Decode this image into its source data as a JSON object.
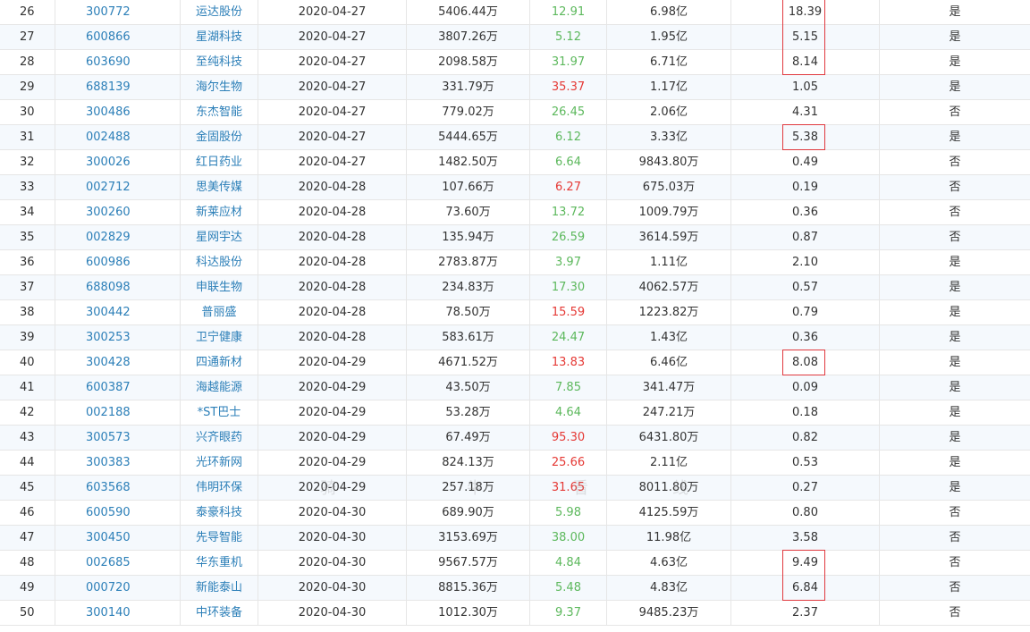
{
  "colors": {
    "link": "#2c7fb8",
    "positive": "#5cb85c",
    "negative": "#e53935",
    "highlight_border": "#e0393e"
  },
  "rows": [
    {
      "idx": "26",
      "code": "300772",
      "name": "运达股份",
      "date": "2020-04-27",
      "amount": "5406.44万",
      "pct": "12.91",
      "dir": "up",
      "cap": "6.98亿",
      "ratio": "18.39",
      "flag": "是",
      "hl": true
    },
    {
      "idx": "27",
      "code": "600866",
      "name": "星湖科技",
      "date": "2020-04-27",
      "amount": "3807.26万",
      "pct": "5.12",
      "dir": "up",
      "cap": "1.95亿",
      "ratio": "5.15",
      "flag": "是",
      "hl": true
    },
    {
      "idx": "28",
      "code": "603690",
      "name": "至纯科技",
      "date": "2020-04-27",
      "amount": "2098.58万",
      "pct": "31.97",
      "dir": "up",
      "cap": "6.71亿",
      "ratio": "8.14",
      "flag": "是",
      "hl": true
    },
    {
      "idx": "29",
      "code": "688139",
      "name": "海尔生物",
      "date": "2020-04-27",
      "amount": "331.79万",
      "pct": "35.37",
      "dir": "down",
      "cap": "1.17亿",
      "ratio": "1.05",
      "flag": "是",
      "hl": false
    },
    {
      "idx": "30",
      "code": "300486",
      "name": "东杰智能",
      "date": "2020-04-27",
      "amount": "779.02万",
      "pct": "26.45",
      "dir": "up",
      "cap": "2.06亿",
      "ratio": "4.31",
      "flag": "否",
      "hl": false
    },
    {
      "idx": "31",
      "code": "002488",
      "name": "金固股份",
      "date": "2020-04-27",
      "amount": "5444.65万",
      "pct": "6.12",
      "dir": "up",
      "cap": "3.33亿",
      "ratio": "5.38",
      "flag": "是",
      "hl": true
    },
    {
      "idx": "32",
      "code": "300026",
      "name": "红日药业",
      "date": "2020-04-27",
      "amount": "1482.50万",
      "pct": "6.64",
      "dir": "up",
      "cap": "9843.80万",
      "ratio": "0.49",
      "flag": "否",
      "hl": false
    },
    {
      "idx": "33",
      "code": "002712",
      "name": "思美传媒",
      "date": "2020-04-28",
      "amount": "107.66万",
      "pct": "6.27",
      "dir": "down",
      "cap": "675.03万",
      "ratio": "0.19",
      "flag": "否",
      "hl": false
    },
    {
      "idx": "34",
      "code": "300260",
      "name": "新莱应材",
      "date": "2020-04-28",
      "amount": "73.60万",
      "pct": "13.72",
      "dir": "up",
      "cap": "1009.79万",
      "ratio": "0.36",
      "flag": "否",
      "hl": false
    },
    {
      "idx": "35",
      "code": "002829",
      "name": "星网宇达",
      "date": "2020-04-28",
      "amount": "135.94万",
      "pct": "26.59",
      "dir": "up",
      "cap": "3614.59万",
      "ratio": "0.87",
      "flag": "否",
      "hl": false
    },
    {
      "idx": "36",
      "code": "600986",
      "name": "科达股份",
      "date": "2020-04-28",
      "amount": "2783.87万",
      "pct": "3.97",
      "dir": "up",
      "cap": "1.11亿",
      "ratio": "2.10",
      "flag": "是",
      "hl": false
    },
    {
      "idx": "37",
      "code": "688098",
      "name": "申联生物",
      "date": "2020-04-28",
      "amount": "234.83万",
      "pct": "17.30",
      "dir": "up",
      "cap": "4062.57万",
      "ratio": "0.57",
      "flag": "是",
      "hl": false
    },
    {
      "idx": "38",
      "code": "300442",
      "name": "普丽盛",
      "date": "2020-04-28",
      "amount": "78.50万",
      "pct": "15.59",
      "dir": "down",
      "cap": "1223.82万",
      "ratio": "0.79",
      "flag": "是",
      "hl": false
    },
    {
      "idx": "39",
      "code": "300253",
      "name": "卫宁健康",
      "date": "2020-04-28",
      "amount": "583.61万",
      "pct": "24.47",
      "dir": "up",
      "cap": "1.43亿",
      "ratio": "0.36",
      "flag": "是",
      "hl": false
    },
    {
      "idx": "40",
      "code": "300428",
      "name": "四通新材",
      "date": "2020-04-29",
      "amount": "4671.52万",
      "pct": "13.83",
      "dir": "down",
      "cap": "6.46亿",
      "ratio": "8.08",
      "flag": "是",
      "hl": true
    },
    {
      "idx": "41",
      "code": "600387",
      "name": "海越能源",
      "date": "2020-04-29",
      "amount": "43.50万",
      "pct": "7.85",
      "dir": "up",
      "cap": "341.47万",
      "ratio": "0.09",
      "flag": "是",
      "hl": false
    },
    {
      "idx": "42",
      "code": "002188",
      "name": "*ST巴士",
      "date": "2020-04-29",
      "amount": "53.28万",
      "pct": "4.64",
      "dir": "up",
      "cap": "247.21万",
      "ratio": "0.18",
      "flag": "是",
      "hl": false
    },
    {
      "idx": "43",
      "code": "300573",
      "name": "兴齐眼药",
      "date": "2020-04-29",
      "amount": "67.49万",
      "pct": "95.30",
      "dir": "down",
      "cap": "6431.80万",
      "ratio": "0.82",
      "flag": "是",
      "hl": false
    },
    {
      "idx": "44",
      "code": "300383",
      "name": "光环新网",
      "date": "2020-04-29",
      "amount": "824.13万",
      "pct": "25.66",
      "dir": "down",
      "cap": "2.11亿",
      "ratio": "0.53",
      "flag": "是",
      "hl": false
    },
    {
      "idx": "45",
      "code": "603568",
      "name": "伟明环保",
      "date": "2020-04-29",
      "amount": "257.18万",
      "pct": "31.65",
      "dir": "down",
      "cap": "8011.80万",
      "ratio": "0.27",
      "flag": "是",
      "hl": false
    },
    {
      "idx": "46",
      "code": "600590",
      "name": "泰豪科技",
      "date": "2020-04-30",
      "amount": "689.90万",
      "pct": "5.98",
      "dir": "up",
      "cap": "4125.59万",
      "ratio": "0.80",
      "flag": "否",
      "hl": false
    },
    {
      "idx": "47",
      "code": "300450",
      "name": "先导智能",
      "date": "2020-04-30",
      "amount": "3153.69万",
      "pct": "38.00",
      "dir": "up",
      "cap": "11.98亿",
      "ratio": "3.58",
      "flag": "否",
      "hl": false
    },
    {
      "idx": "48",
      "code": "002685",
      "name": "华东重机",
      "date": "2020-04-30",
      "amount": "9567.57万",
      "pct": "4.84",
      "dir": "up",
      "cap": "4.63亿",
      "ratio": "9.49",
      "flag": "否",
      "hl": true
    },
    {
      "idx": "49",
      "code": "000720",
      "name": "新能泰山",
      "date": "2020-04-30",
      "amount": "8815.36万",
      "pct": "5.48",
      "dir": "up",
      "cap": "4.83亿",
      "ratio": "6.84",
      "flag": "否",
      "hl": true
    },
    {
      "idx": "50",
      "code": "300140",
      "name": "中环装备",
      "date": "2020-04-30",
      "amount": "1012.30万",
      "pct": "9.37",
      "dir": "up",
      "cap": "9485.23万",
      "ratio": "2.37",
      "flag": "否",
      "hl": false
    }
  ],
  "watermark": [
    "骑",
    "牛",
    "看",
    "线"
  ]
}
